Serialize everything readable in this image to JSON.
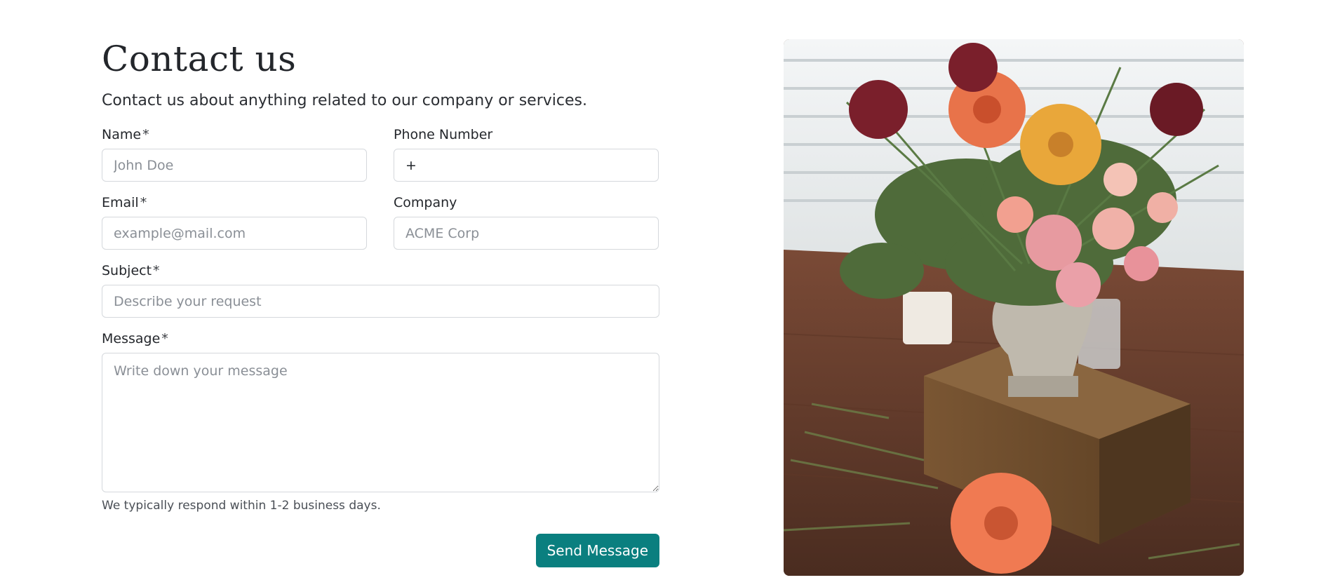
{
  "header": {
    "title": "Contact us",
    "subtitle": "Contact us about anything related to our company or services."
  },
  "form": {
    "name": {
      "label": "Name",
      "required_mark": "*",
      "placeholder": "John Doe",
      "value": ""
    },
    "phone": {
      "label": "Phone Number",
      "value": "+"
    },
    "email": {
      "label": "Email",
      "required_mark": "*",
      "placeholder": "example@mail.com",
      "value": ""
    },
    "company": {
      "label": "Company",
      "placeholder": "ACME Corp",
      "value": ""
    },
    "subject": {
      "label": "Subject",
      "required_mark": "*",
      "placeholder": "Describe your request",
      "value": ""
    },
    "message": {
      "label": "Message",
      "required_mark": "*",
      "placeholder": "Write down your message",
      "value": ""
    },
    "hint": "We typically respond within 1-2 business days.",
    "submit_label": "Send Message"
  },
  "image": {
    "alt": "Flower arrangement in a stone urn on a wooden box"
  },
  "colors": {
    "accent": "#0a7f7f",
    "border": "#d5d8dc",
    "text": "#1f2328",
    "placeholder": "#8a8f96"
  }
}
